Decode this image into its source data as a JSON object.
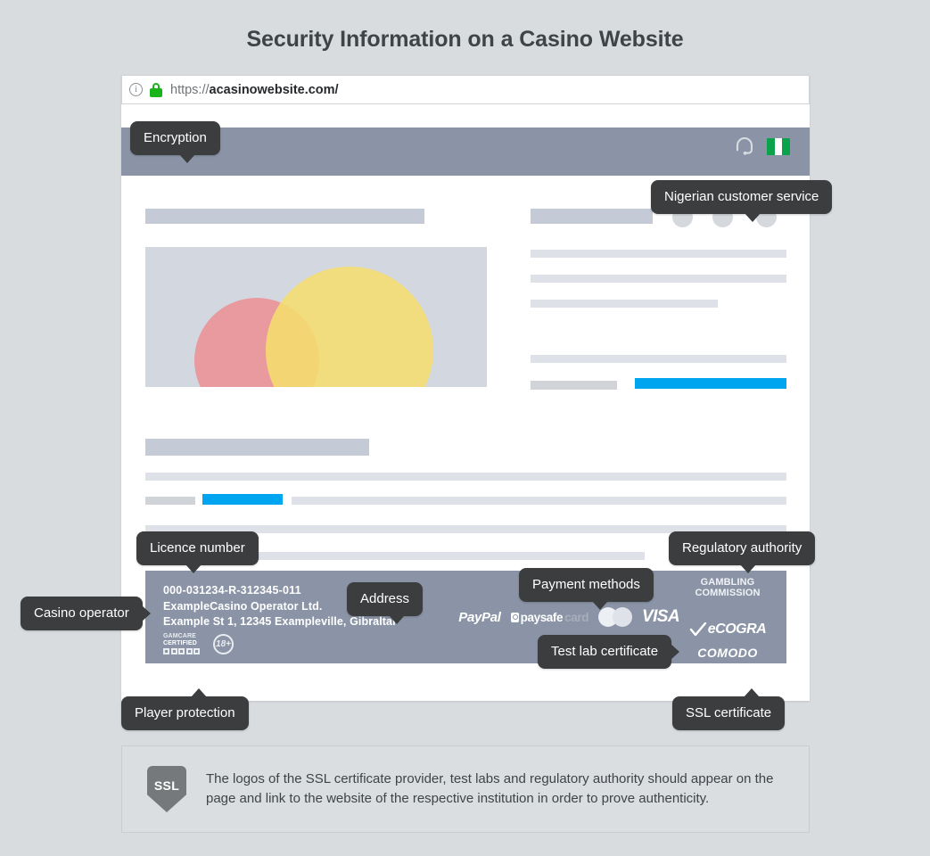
{
  "page": {
    "title": "Security Information on a Casino Website",
    "background_color": "#d8dcdf"
  },
  "browser": {
    "url_scheme": "https://",
    "url_domain": "acasinowebsite.com/",
    "info_icon": "info-circle-icon",
    "lock_icon": "green-padlock-icon",
    "lock_color": "#19b419"
  },
  "site": {
    "header": {
      "background_color": "#8a94a6",
      "support_icon": "headset-icon",
      "flag_icon": "nigeria-flag-icon",
      "flag_colors": [
        "#0aa24a",
        "#ffffff",
        "#0aa24a"
      ]
    },
    "accent_color": "#00a5f0",
    "placeholder_color": "#dee1e8",
    "media_circles": [
      {
        "name": "pink-circle",
        "color": "#e89a9e"
      },
      {
        "name": "yellow-circle",
        "color": "#f5dd6e"
      }
    ],
    "footer": {
      "background_color": "#8a94a6",
      "licence_number": "000-031234-R-312345-011",
      "operator": "ExampleCasino Operator Ltd.",
      "address": "Example St 1, 12345 Exampleville, Gibraltar",
      "player_protection": {
        "gamcare_line1": "GAMCARE",
        "gamcare_line2": "CERTIFIED",
        "age_badge": "18+"
      },
      "payment_methods": [
        {
          "name": "paypal-logo",
          "label": "PayPal"
        },
        {
          "name": "paysafecard-logo",
          "label_bold": "paysafe",
          "label_light": "card"
        },
        {
          "name": "mastercard-logo",
          "label": ""
        },
        {
          "name": "visa-logo",
          "label": "VISA"
        }
      ],
      "certifications": [
        {
          "name": "gambling-commission-logo",
          "line1": "GAMBLING",
          "line2": "COMMISSION"
        },
        {
          "name": "ecogra-logo",
          "label": "eCOGRA"
        },
        {
          "name": "comodo-logo",
          "label": "COMODO"
        }
      ]
    }
  },
  "callouts": {
    "encryption": "Encryption",
    "customer_service": "Nigerian customer service",
    "licence_number": "Licence number",
    "regulatory_authority": "Regulatory authority",
    "casino_operator": "Casino operator",
    "address": "Address",
    "payment_methods": "Payment methods",
    "test_lab": "Test lab certificate",
    "player_protection": "Player protection",
    "ssl_certificate": "SSL certificate"
  },
  "note": {
    "icon_label": "SSL",
    "icon_name": "ssl-shield-icon",
    "text": "The logos of the SSL certificate provider, test labs and regulatory authority should appear on the page and link to the website of the respective institution in order to prove authenticity."
  }
}
